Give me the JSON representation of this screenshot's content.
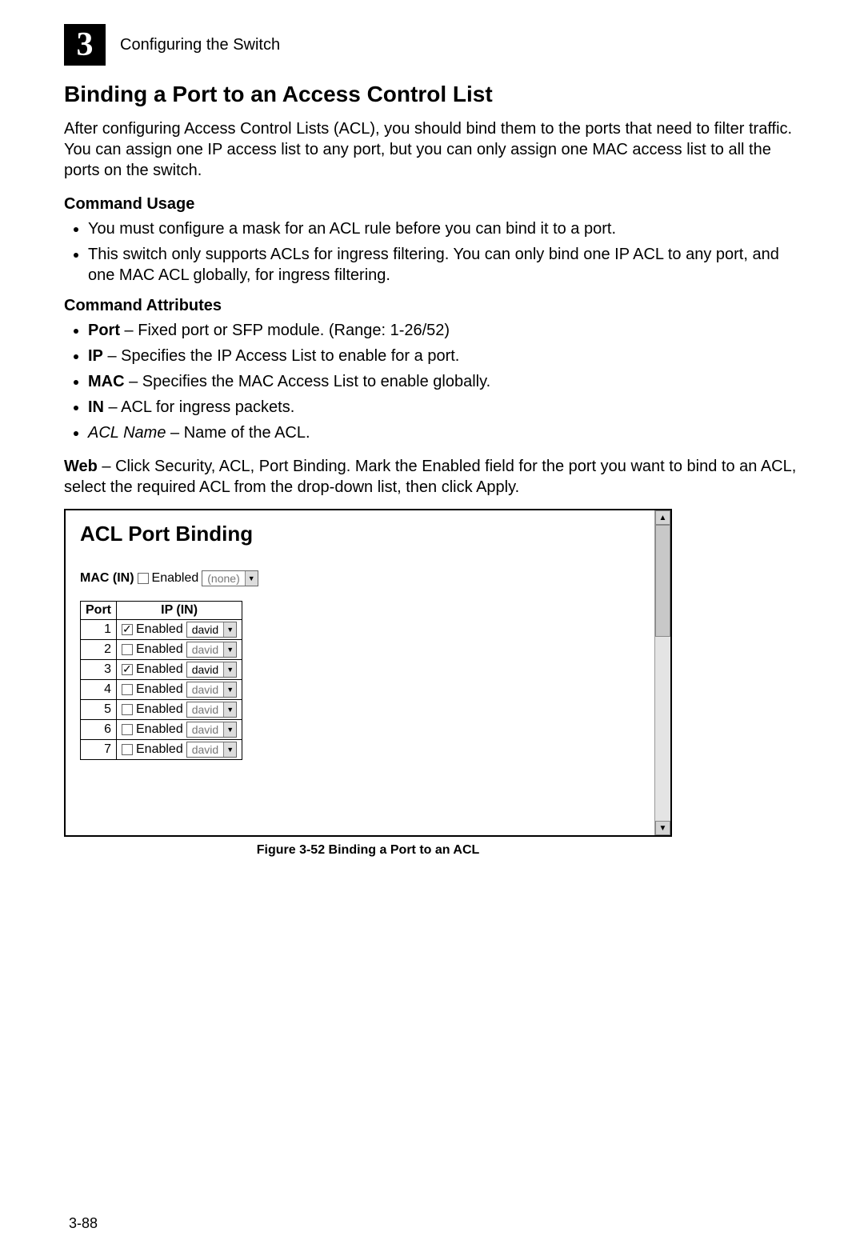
{
  "header": {
    "chapter_number": "3",
    "chapter_label": "Configuring the Switch"
  },
  "section": {
    "heading": "Binding a Port to an Access Control List",
    "intro": "After configuring Access Control Lists (ACL), you should bind them to the ports that need to filter traffic. You can assign one IP access list to any port, but you can only assign one MAC access list to all the ports on the switch."
  },
  "command_usage": {
    "heading": "Command Usage",
    "items": [
      "You must configure a mask for an ACL rule before you can bind it to a port.",
      "This switch only supports ACLs for ingress filtering. You can only bind one IP ACL to any port, and one MAC ACL globally, for ingress filtering."
    ]
  },
  "command_attributes": {
    "heading": "Command Attributes",
    "items": [
      {
        "term": "Port",
        "desc": " – Fixed port or SFP module. (Range: 1-26/52)"
      },
      {
        "term": "IP",
        "desc": " – Specifies the IP Access List to enable for a port."
      },
      {
        "term": "MAC",
        "desc": " – Specifies the MAC Access List to enable globally."
      },
      {
        "term": "IN",
        "desc": " – ACL for ingress packets."
      },
      {
        "term_italic": "ACL Name",
        "desc": " – Name of the ACL."
      }
    ]
  },
  "web": {
    "label": "Web",
    "text": " – Click Security, ACL, Port Binding. Mark the Enabled field for the port you want to bind to an ACL, select the required ACL from the drop-down list, then click Apply."
  },
  "screenshot": {
    "title": "ACL Port Binding",
    "mac_label": "MAC (IN)",
    "enabled_label": "Enabled",
    "mac_value": "(none)",
    "table": {
      "port_header": "Port",
      "ip_header": "IP (IN)",
      "rows": [
        {
          "port": "1",
          "checked": true,
          "acl": "david"
        },
        {
          "port": "2",
          "checked": false,
          "acl": "david"
        },
        {
          "port": "3",
          "checked": true,
          "acl": "david"
        },
        {
          "port": "4",
          "checked": false,
          "acl": "david"
        },
        {
          "port": "5",
          "checked": false,
          "acl": "david"
        },
        {
          "port": "6",
          "checked": false,
          "acl": "david"
        },
        {
          "port": "7",
          "checked": false,
          "acl": "david"
        }
      ]
    }
  },
  "figure_caption": "Figure 3-52  Binding a Port to an ACL",
  "page_number": "3-88"
}
